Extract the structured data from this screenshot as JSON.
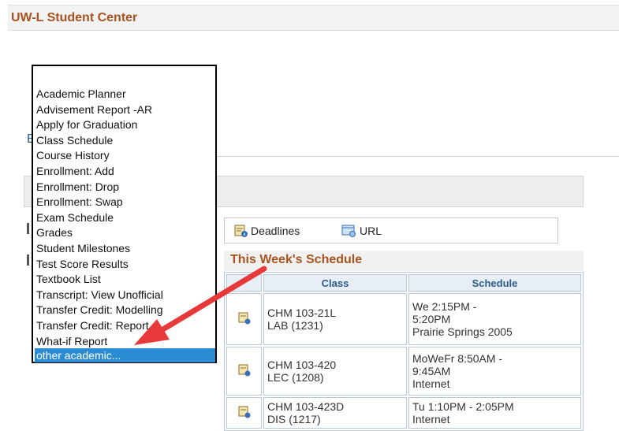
{
  "page": {
    "title": "UW-L Student Center",
    "fragment_letter": "E"
  },
  "dropdown": {
    "options": [
      "Academic Planner",
      "Advisement Report -AR",
      "Apply for Graduation",
      "Class Schedule",
      "Course History",
      "Enrollment: Add",
      "Enrollment: Drop",
      "Enrollment: Swap",
      "Exam Schedule",
      "Grades",
      "Student Milestones",
      "Test Score Results",
      "Textbook List",
      "Transcript: View Unofficial",
      "Transfer Credit: Modelling",
      "Transfer Credit: Report",
      "What-if Report"
    ],
    "selected": "other academic..."
  },
  "quick_links": {
    "deadlines": "Deadlines",
    "url": "URL"
  },
  "schedule": {
    "title": "This Week's Schedule",
    "columns": [
      "Class",
      "Schedule"
    ],
    "rows": [
      {
        "class_line1": "CHM 103-21L",
        "class_line2": "LAB (1231)",
        "sched": [
          "We 2:15PM -",
          "5:20PM",
          "Prairie Springs 2005"
        ]
      },
      {
        "class_line1": "CHM 103-420",
        "class_line2": "LEC (1208)",
        "sched": [
          "MoWeFr 8:50AM -",
          "9:45AM",
          "Internet"
        ]
      },
      {
        "class_line1": "CHM 103-423D",
        "class_line2": "DIS (1217)",
        "sched": [
          "Tu 1:10PM - 2:05PM",
          "Internet"
        ]
      }
    ]
  },
  "colors": {
    "accent_title": "#a8531f",
    "link_blue": "#2a5b8c",
    "selection": "#2a8dd4",
    "arrow": "#e8393a"
  }
}
